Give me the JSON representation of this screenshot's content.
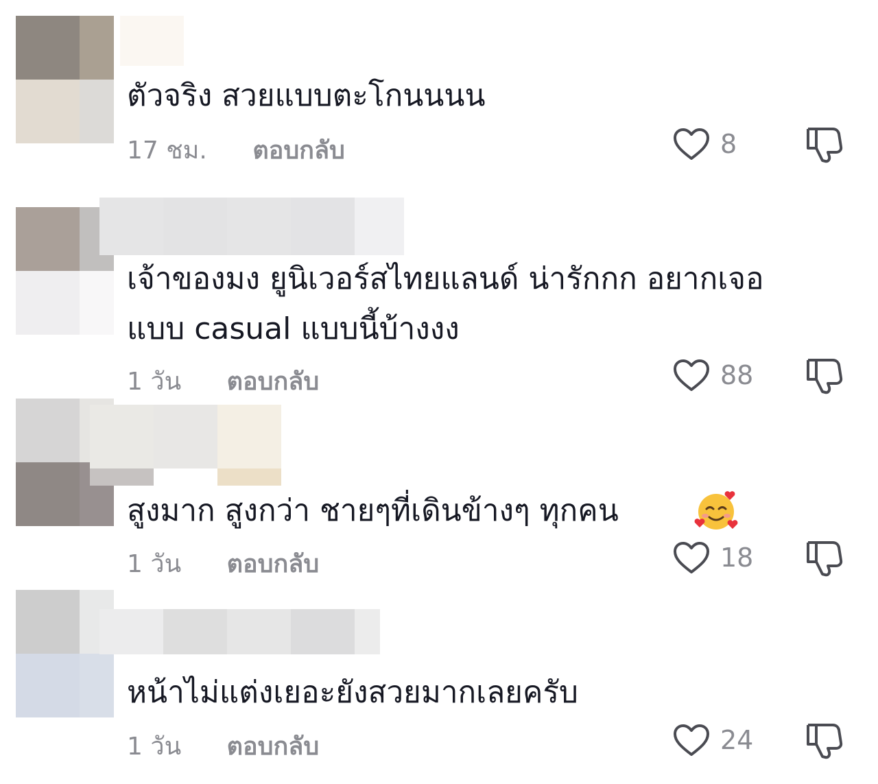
{
  "comments": [
    {
      "text": "ตัวจริง สวยแบบตะโกนนนน",
      "time": "17 ชม.",
      "reply": "ตอบกลับ",
      "likes": "8",
      "like_icon": "heart-outline-icon",
      "dislike_icon": "thumbs-down-icon"
    },
    {
      "text_line1": "เจ้าของมง ยูนิเวอร์สไทยแลนด์ น่ารักกก อยากเจอ",
      "text_line2": "แบบ casual แบบนี้บ้างงง",
      "time": "1 วัน",
      "reply": "ตอบกลับ",
      "likes": "88",
      "like_icon": "heart-outline-icon",
      "dislike_icon": "thumbs-down-icon"
    },
    {
      "text": "สูงมาก สูงกว่า ชายๆที่เดินข้างๆ ทุกคน",
      "emoji": "smiling-face-with-hearts-emoji",
      "time": "1 วัน",
      "reply": "ตอบกลับ",
      "likes": "18",
      "like_icon": "heart-outline-icon",
      "dislike_icon": "thumbs-down-icon"
    },
    {
      "text": "หน้าไม่แต่งเยอะยังสวยมากเลยครับ",
      "time": "1 วัน",
      "reply": "ตอบกลับ",
      "likes": "24",
      "like_icon": "heart-outline-icon",
      "dislike_icon": "thumbs-down-icon"
    }
  ],
  "colors": {
    "text": "#161823",
    "meta": "#8a8b91"
  }
}
